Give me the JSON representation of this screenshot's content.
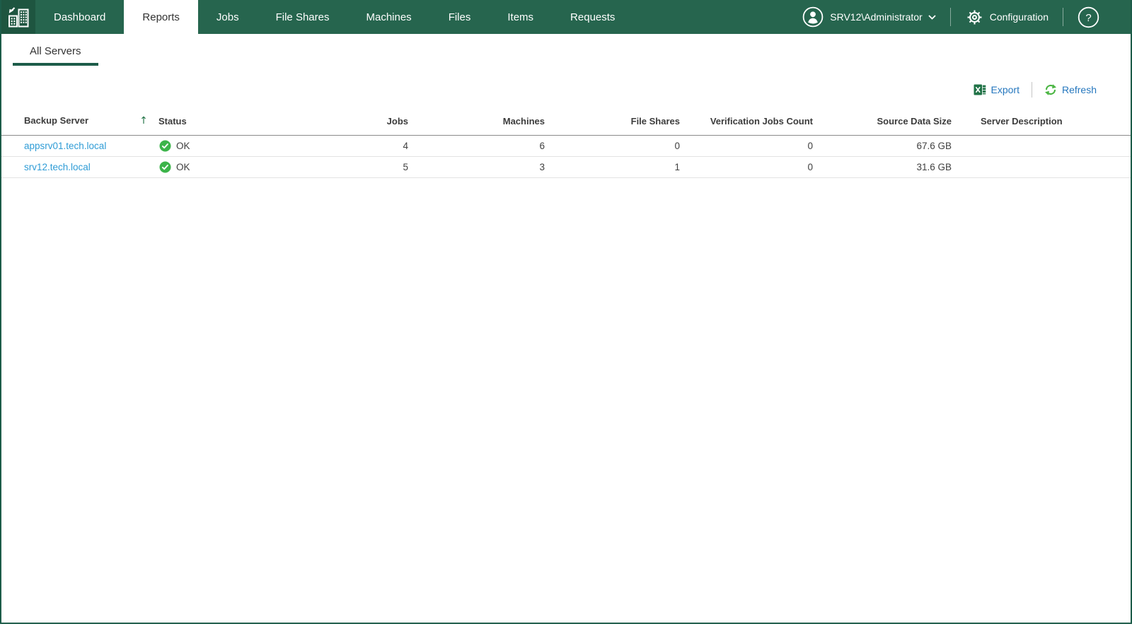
{
  "header": {
    "nav": [
      {
        "label": "Dashboard",
        "active": false
      },
      {
        "label": "Reports",
        "active": true
      },
      {
        "label": "Jobs",
        "active": false
      },
      {
        "label": "File Shares",
        "active": false
      },
      {
        "label": "Machines",
        "active": false
      },
      {
        "label": "Files",
        "active": false
      },
      {
        "label": "Items",
        "active": false
      },
      {
        "label": "Requests",
        "active": false
      }
    ],
    "user": {
      "name": "SRV12\\Administrator"
    },
    "configuration_label": "Configuration",
    "icons": [
      "app-logo-icon",
      "user-avatar-icon",
      "chevron-down-icon",
      "gear-icon",
      "help-icon"
    ],
    "colors": {
      "brand_green": "#26654e",
      "logo_tile_green": "#1e5540",
      "border_green": "#1d5c49"
    }
  },
  "subtabs": [
    {
      "label": "All Servers",
      "active": true
    }
  ],
  "toolbar": {
    "export_label": "Export",
    "refresh_label": "Refresh",
    "icons": [
      "excel-icon",
      "refresh-icon"
    ],
    "colors": {
      "link_blue": "#2577be",
      "excel_green": "#1f7246",
      "refresh_green": "#4bb543"
    }
  },
  "table": {
    "columns": [
      {
        "label": "Backup Server",
        "sorted": "ascending"
      },
      {
        "label": "Status"
      },
      {
        "label": "Jobs"
      },
      {
        "label": "Machines"
      },
      {
        "label": "File Shares"
      },
      {
        "label": "Verification Jobs Count"
      },
      {
        "label": "Source Data Size"
      },
      {
        "label": "Server Description"
      }
    ],
    "rows": [
      {
        "server": "appsrv01.tech.local",
        "status": "OK",
        "jobs": "4",
        "machines": "6",
        "file_shares": "0",
        "verification_jobs": "0",
        "source_size": "67.6 GB",
        "description": ""
      },
      {
        "server": "srv12.tech.local",
        "status": "OK",
        "jobs": "5",
        "machines": "3",
        "file_shares": "1",
        "verification_jobs": "0",
        "source_size": "31.6 GB",
        "description": ""
      }
    ],
    "colors": {
      "status_ok_green": "#3cb44a",
      "server_link_blue": "#2f9cd6"
    }
  }
}
